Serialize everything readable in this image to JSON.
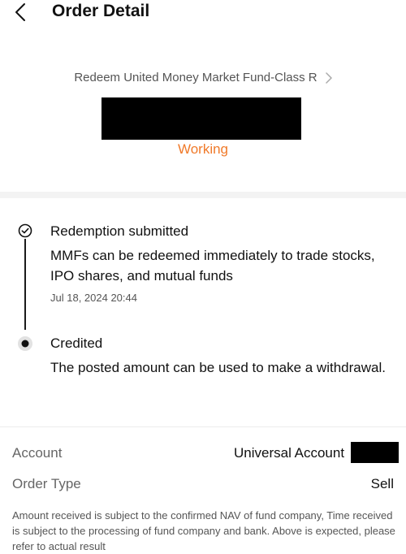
{
  "header": {
    "title": "Order Detail"
  },
  "order": {
    "product_name": "Redeem United Money Market Fund-Class R",
    "status": "Working",
    "status_color": "#f07a2a"
  },
  "timeline": [
    {
      "title": "Redemption submitted",
      "description": "MMFs can be redeemed immediately to trade stocks, IPO shares, and mutual funds",
      "time": "Jul 18, 2024 20:44",
      "state": "done"
    },
    {
      "title": "Credited",
      "description": "The posted amount can be used to make a withdrawal.",
      "state": "pending"
    }
  ],
  "details": {
    "account_label": "Account",
    "account_value": "Universal Account",
    "order_type_label": "Order Type",
    "order_type_value": "Sell"
  },
  "disclaimer": "Amount received  is subject to the confirmed NAV of fund company, Time received is subject to the processing of fund company and bank. Above is expected, please refer to actual result"
}
